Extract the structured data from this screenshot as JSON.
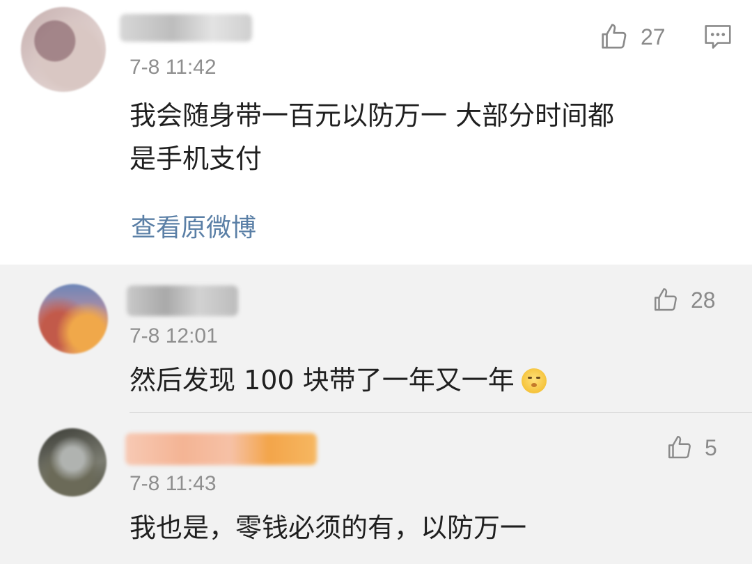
{
  "main_comment": {
    "time": "7-8 11:42",
    "text_line1": "我会随身带一百元以防万一  大部分时间都",
    "text_line2": "是手机支付",
    "likes": "27",
    "view_original_link": "查看原微博",
    "icons": {
      "like": "thumbs-up-icon",
      "comment": "comment-icon"
    }
  },
  "replies": [
    {
      "time": "7-8 12:01",
      "text": "然后发现 100 块带了一年又一年",
      "likes": "28",
      "emoji": "shushing-face-emoji"
    },
    {
      "time": "7-8 11:43",
      "text": "我也是，零钱必须的有，以防万一",
      "likes": "5"
    }
  ],
  "colors": {
    "link": "#5a7fa6",
    "reply_background": "#f2f2f2",
    "meta_text": "#8e8e8e"
  }
}
